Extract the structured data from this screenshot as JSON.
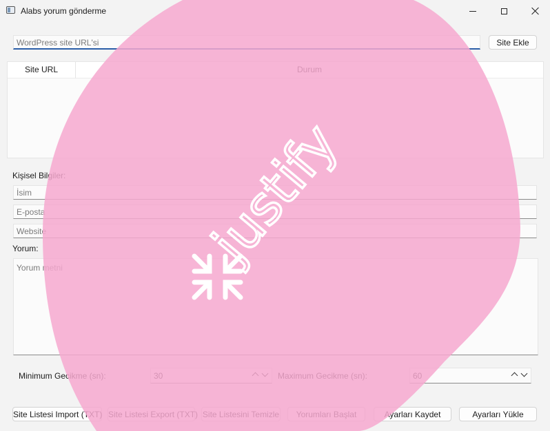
{
  "window": {
    "title": "Alabs yorum gönderme"
  },
  "top": {
    "url_placeholder": "WordPress site URL'si",
    "add_button": "Site Ekle"
  },
  "table": {
    "columns": [
      "Site URL",
      "Durum"
    ]
  },
  "personal": {
    "heading": "Kişisel Bilgiler:",
    "name_placeholder": "İsim",
    "email_placeholder": "E-posta",
    "website_placeholder": "Website"
  },
  "comment": {
    "heading": "Yorum:",
    "placeholder": "Yorum metni"
  },
  "delays": {
    "min_label": "Minimum Gecikme (sn):",
    "min_value": "30",
    "max_label": "Maximum Gecikme (sn):",
    "max_value": "60"
  },
  "buttons": [
    "Site Listesi Import (TXT)",
    "Site Listesi Export (TXT)",
    "Site Listesini Temizle",
    "Yorumları Başlat",
    "Ayarları Kaydet",
    "Ayarları Yükle"
  ],
  "watermark": {
    "text": "justify",
    "color": "#f6a8cf"
  }
}
